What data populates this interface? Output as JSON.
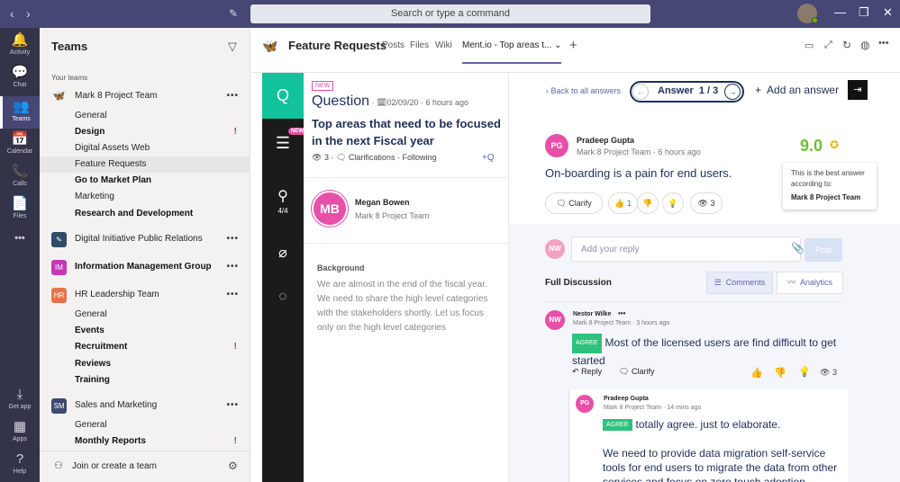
{
  "titlebar": {
    "search_placeholder": "Search or type a command",
    "back": "‹",
    "forward": "›",
    "compose": "✎",
    "minimize": "—",
    "maximize": "❐",
    "close": "✕"
  },
  "rail": [
    {
      "label": "Activity",
      "glyph": "🔔"
    },
    {
      "label": "Chat",
      "glyph": "💬"
    },
    {
      "label": "Teams",
      "glyph": "👥"
    },
    {
      "label": "Calendar",
      "glyph": "📅"
    },
    {
      "label": "Calls",
      "glyph": "📞"
    },
    {
      "label": "Files",
      "glyph": "📄"
    },
    {
      "label": "",
      "glyph": "•••"
    },
    {
      "label": "Get app",
      "glyph": "⤓"
    },
    {
      "label": "Apps",
      "glyph": "▦"
    },
    {
      "label": "Help",
      "glyph": "?"
    }
  ],
  "teams": {
    "title": "Teams",
    "filter": "▽",
    "your_teams": "Your teams",
    "rows": [
      {
        "type": "team",
        "label": "Mark 8 Project Team",
        "icon": "🦋",
        "color": "#f3f2f1"
      },
      {
        "type": "channel",
        "label": "General"
      },
      {
        "type": "channel",
        "label": "Design",
        "bold": true,
        "alert": "!"
      },
      {
        "type": "channel",
        "label": "Digital Assets Web"
      },
      {
        "type": "channel",
        "label": "Feature Requests",
        "selected": true
      },
      {
        "type": "channel",
        "label": "Go to Market Plan",
        "bold": true
      },
      {
        "type": "channel",
        "label": "Marketing"
      },
      {
        "type": "channel",
        "label": "Research and Development",
        "bold": true
      },
      {
        "type": "team",
        "label": "Digital Initiative Public Relations",
        "icon": "✎",
        "color": "#2f4a6b"
      },
      {
        "type": "team",
        "label": "Information Management Group",
        "icon": "IM",
        "color": "#c239b3",
        "bold": true
      },
      {
        "type": "team",
        "label": "HR Leadership Team",
        "icon": "HR",
        "color": "#e8734a"
      },
      {
        "type": "channel",
        "label": "General"
      },
      {
        "type": "channel",
        "label": "Events",
        "bold": true
      },
      {
        "type": "channel",
        "label": "Recruitment",
        "bold": true,
        "alert": "!"
      },
      {
        "type": "channel",
        "label": "Reviews",
        "bold": true
      },
      {
        "type": "channel",
        "label": "Training",
        "bold": true
      },
      {
        "type": "team",
        "label": "Sales and Marketing",
        "icon": "SM",
        "color": "#3d4a6e"
      },
      {
        "type": "channel",
        "label": "General"
      },
      {
        "type": "channel",
        "label": "Monthly Reports",
        "bold": true,
        "alert": "!"
      }
    ],
    "join": "Join or create a team",
    "more": "•••",
    "settings": "⚙"
  },
  "header": {
    "title": "Feature Requests",
    "tabs": [
      "Posts",
      "Files",
      "Wiki",
      "Ment.io - Top areas t..."
    ],
    "add_tab": "+"
  },
  "question": {
    "new_badge": "NEW",
    "label": "Question",
    "date": "02/09/20",
    "time": "6 hours ago",
    "title": "Top areas that need to be focused in the next Fiscal year",
    "views": "3",
    "clarifications": "Clarifications",
    "following": "Following",
    "author": {
      "initials": "MB",
      "name": "Megan Bowen",
      "team": "Mark 8 Project Team"
    },
    "background_label": "Background",
    "background_text": "We are almost in the end of the fiscal year. We need to share the high level categories with the stakeholders shortly. Let us focus only on the high level categories"
  },
  "sidestrip": {
    "q": "Q",
    "new": "NEW",
    "progress": "4/4"
  },
  "answer": {
    "back": "Back to all answers",
    "label": "Answer",
    "counter": "1 / 3",
    "add": "Add an answer",
    "author": {
      "initials": "PG",
      "name": "Pradeep Gupta",
      "team": "Mark 8 Project Team",
      "time": "6 hours ago"
    },
    "text": "On-boarding is a pain for end users.",
    "score": "9.0",
    "tooltip": {
      "text": "This is the best answer according to:",
      "team": "Mark 8 Project Team"
    },
    "clarify": "Clarify",
    "likes": "1",
    "views": "3",
    "reply_initials": "NW",
    "reply_placeholder": "Add your reply",
    "post": "Post"
  },
  "discussion": {
    "title": "Full Discussion",
    "comments_tab": "Comments",
    "analytics_tab": "Analytics",
    "comment1": {
      "initials": "NW",
      "name": "Nestor Wilke",
      "team": "Mark 8 Project Team",
      "time": "3 hours ago",
      "agree": "AGREE",
      "text": "Most of the licensed users are find difficult to get started",
      "reply": "Reply",
      "clarify": "Clarify",
      "views": "3"
    },
    "comment2": {
      "initials": "PG",
      "name": "Pradeep Gupta",
      "team": "Mark 8 Project Team",
      "time": "14 mins ago",
      "agree": "AGREE",
      "text": "totally agree. just to elaborate.",
      "text2": "We need to provide data migration self-service tools for end users to migrate the data from other services and focus on zero touch adoption"
    }
  },
  "colors": {
    "rail": "#33344a",
    "titlebar": "#464775",
    "accent": "#6264a7",
    "teal": "#12c29c",
    "green": "#2ec27e",
    "pink": "#e84fa8",
    "score": "#6fbf2f"
  }
}
